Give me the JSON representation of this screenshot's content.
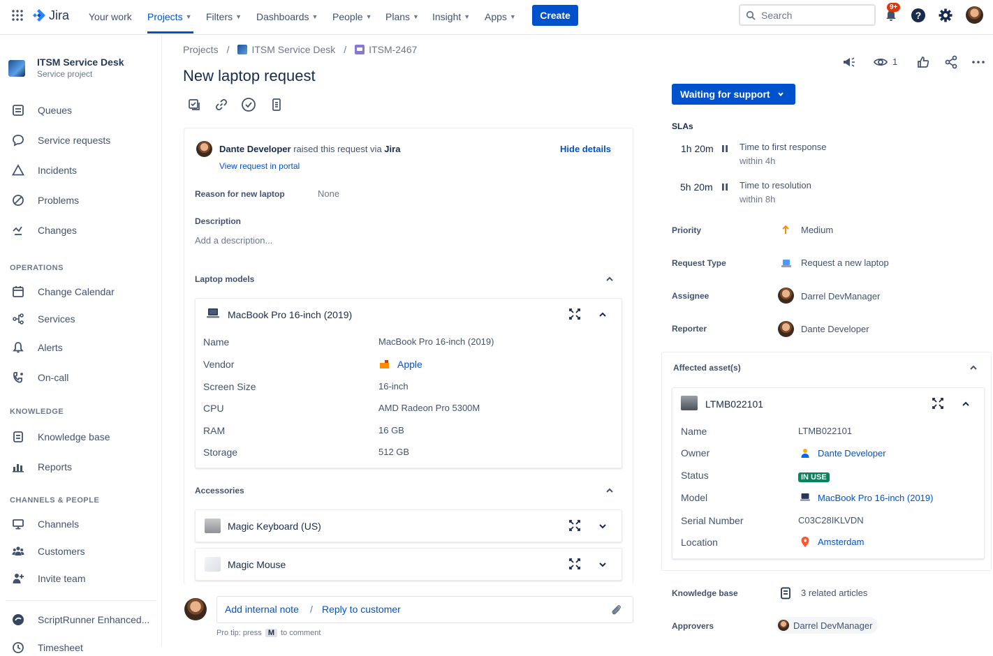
{
  "nav": {
    "product": "Jira",
    "items": [
      {
        "label": "Your work",
        "chevron": false
      },
      {
        "label": "Projects",
        "chevron": true
      },
      {
        "label": "Filters",
        "chevron": true
      },
      {
        "label": "Dashboards",
        "chevron": true
      },
      {
        "label": "People",
        "chevron": true
      },
      {
        "label": "Plans",
        "chevron": true
      },
      {
        "label": "Insight",
        "chevron": true
      },
      {
        "label": "Apps",
        "chevron": true
      }
    ],
    "create": "Create",
    "search_placeholder": "Search",
    "notifications_badge": "9+"
  },
  "sidebar": {
    "project_name": "ITSM Service Desk",
    "project_type": "Service project",
    "items": [
      "Queues",
      "Service requests",
      "Incidents",
      "Problems",
      "Changes"
    ],
    "operations_heading": "OPERATIONS",
    "operations": [
      "Change Calendar",
      "Services",
      "Alerts",
      "On-call"
    ],
    "knowledge_heading": "KNOWLEDGE",
    "knowledge": [
      "Knowledge base",
      "Reports"
    ],
    "channels_heading": "CHANNELS & PEOPLE",
    "channels": [
      "Channels",
      "Customers",
      "Invite team"
    ],
    "apps": [
      "ScriptRunner Enhanced...",
      "Timesheet"
    ]
  },
  "breadcrumb": {
    "projects": "Projects",
    "sep": "/",
    "project": "ITSM Service Desk",
    "issue": "ITSM-2467"
  },
  "issue": {
    "title": "New laptop request",
    "reporter_name": "Dante Developer",
    "raised_text": "raised this request via",
    "channel": "Jira",
    "hide_details": "Hide details",
    "view_portal": "View request in portal",
    "reason_label": "Reason for new laptop",
    "reason_value": "None",
    "description_label": "Description",
    "description_placeholder": "Add a description...",
    "watchers": "1"
  },
  "laptop_models": {
    "heading": "Laptop models",
    "asset_name": "MacBook Pro 16-inch (2019)",
    "fields": [
      {
        "label": "Name",
        "value": "MacBook Pro 16-inch (2019)"
      },
      {
        "label": "Vendor",
        "value": "Apple"
      },
      {
        "label": "Screen Size",
        "value": "16-inch"
      },
      {
        "label": "CPU",
        "value": "AMD Radeon Pro 5300M"
      },
      {
        "label": "RAM",
        "value": "16 GB"
      },
      {
        "label": "Storage",
        "value": "512 GB"
      }
    ]
  },
  "accessories": {
    "heading": "Accessories",
    "items": [
      "Magic Keyboard (US)",
      "Magic Mouse"
    ]
  },
  "comment": {
    "add_note": "Add internal note",
    "sep": "/",
    "reply": "Reply to customer",
    "protip_prefix": "Pro tip: press",
    "protip_key": "M",
    "protip_suffix": "to comment"
  },
  "details": {
    "status": "Waiting for support",
    "slas_label": "SLAs",
    "slas": [
      {
        "time": "1h 20m",
        "name": "Time to first response",
        "within": "within 4h"
      },
      {
        "time": "5h 20m",
        "name": "Time to resolution",
        "within": "within 8h"
      }
    ],
    "priority_label": "Priority",
    "priority_value": "Medium",
    "request_type_label": "Request Type",
    "request_type_value": "Request a new laptop",
    "assignee_label": "Assignee",
    "assignee_value": "Darrel DevManager",
    "reporter_label": "Reporter",
    "reporter_value": "Dante Developer",
    "knowledge_label": "Knowledge base",
    "knowledge_value": "3 related articles",
    "approvers_label": "Approvers",
    "approvers_value": "Darrel DevManager"
  },
  "affected": {
    "heading": "Affected asset(s)",
    "asset_name": "LTMB022101",
    "fields": [
      {
        "label": "Name",
        "value": "LTMB022101"
      },
      {
        "label": "Owner",
        "value": "Dante Developer"
      },
      {
        "label": "Status",
        "value": "IN USE"
      },
      {
        "label": "Model",
        "value": "MacBook Pro 16-inch (2019)"
      },
      {
        "label": "Serial Number",
        "value": "C03C28IKLVDN"
      },
      {
        "label": "Location",
        "value": "Amsterdam"
      }
    ]
  },
  "colors": {
    "primary": "#0052cc",
    "status_in_use": "#00875a",
    "priority": "#ff8b00",
    "notification": "#de350b"
  }
}
